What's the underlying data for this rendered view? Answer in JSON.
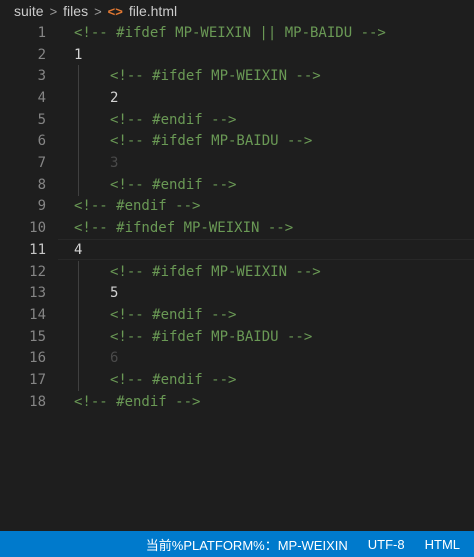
{
  "breadcrumb": {
    "items": [
      "suite",
      "files"
    ],
    "file_icon": "<>",
    "file_name": "file.html"
  },
  "editor": {
    "active_line": 11,
    "lines": [
      {
        "number": "1",
        "text": "<!-- #ifdef MP-WEIXIN || MP-BAIDU -->",
        "kind": "comment",
        "indent": false
      },
      {
        "number": "2",
        "text": "1",
        "kind": "plain",
        "indent": false
      },
      {
        "number": "3",
        "text": "<!-- #ifdef MP-WEIXIN -->",
        "kind": "comment",
        "indent": true
      },
      {
        "number": "4",
        "text": "2",
        "kind": "plain",
        "indent": true
      },
      {
        "number": "5",
        "text": "<!-- #endif -->",
        "kind": "comment",
        "indent": true
      },
      {
        "number": "6",
        "text": "<!-- #ifdef MP-BAIDU -->",
        "kind": "comment",
        "indent": true
      },
      {
        "number": "7",
        "text": "3",
        "kind": "faded",
        "indent": true
      },
      {
        "number": "8",
        "text": "<!-- #endif -->",
        "kind": "comment",
        "indent": true
      },
      {
        "number": "9",
        "text": "<!-- #endif -->",
        "kind": "comment",
        "indent": false
      },
      {
        "number": "10",
        "text": "<!-- #ifndef MP-WEIXIN -->",
        "kind": "comment",
        "indent": false
      },
      {
        "number": "11",
        "text": "4",
        "kind": "plain",
        "indent": false
      },
      {
        "number": "12",
        "text": "<!-- #ifdef MP-WEIXIN -->",
        "kind": "comment",
        "indent": true
      },
      {
        "number": "13",
        "text": "5",
        "kind": "plain",
        "indent": true
      },
      {
        "number": "14",
        "text": "<!-- #endif -->",
        "kind": "comment",
        "indent": true
      },
      {
        "number": "15",
        "text": "<!-- #ifdef MP-BAIDU -->",
        "kind": "comment",
        "indent": true
      },
      {
        "number": "16",
        "text": "6",
        "kind": "faded",
        "indent": true
      },
      {
        "number": "17",
        "text": "<!-- #endif -->",
        "kind": "comment",
        "indent": true
      },
      {
        "number": "18",
        "text": "<!-- #endif -->",
        "kind": "comment",
        "indent": false
      }
    ]
  },
  "statusbar": {
    "platform": "当前%PLATFORM%：MP-WEIXIN",
    "encoding": "UTF-8",
    "language": "HTML"
  },
  "colors": {
    "background": "#1e1e1e",
    "comment": "#6a9955",
    "statusbar": "#007acc",
    "file_icon": "#e37933"
  }
}
